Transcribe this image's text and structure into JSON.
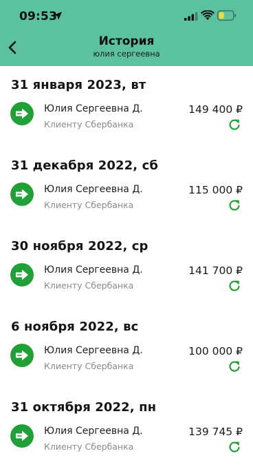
{
  "status_bar": {
    "time": "09:53"
  },
  "header": {
    "title": "История",
    "subtitle": "юлия сергеевна"
  },
  "colors": {
    "header_bg": "#5cc19f",
    "accent_green": "#21a038",
    "battery_fill": "#f2dc3c"
  },
  "icons": {
    "back": "chevron-left-icon",
    "transfer": "transfer-arrow-icon",
    "repeat": "repeat-icon"
  },
  "groups": [
    {
      "date": "31 января 2023, вт",
      "operation": {
        "name": "Юлия Сергеевна Д.",
        "desc": "Клиенту Сбербанка",
        "amount": "149 400 ₽"
      }
    },
    {
      "date": "31 декабря 2022, сб",
      "operation": {
        "name": "Юлия Сергеевна Д.",
        "desc": "Клиенту Сбербанка",
        "amount": "115 000 ₽"
      }
    },
    {
      "date": "30 ноября 2022, ср",
      "operation": {
        "name": "Юлия Сергеевна Д.",
        "desc": "Клиенту Сбербанка",
        "amount": "141 700 ₽"
      }
    },
    {
      "date": "6 ноября 2022, вс",
      "operation": {
        "name": "Юлия Сергеевна Д.",
        "desc": "Клиенту Сбербанка",
        "amount": "100 000 ₽"
      }
    },
    {
      "date": "31 октября 2022, пн",
      "operation": {
        "name": "Юлия Сергеевна Д.",
        "desc": "Клиенту Сбербанка",
        "amount": "139 745 ₽"
      }
    }
  ]
}
